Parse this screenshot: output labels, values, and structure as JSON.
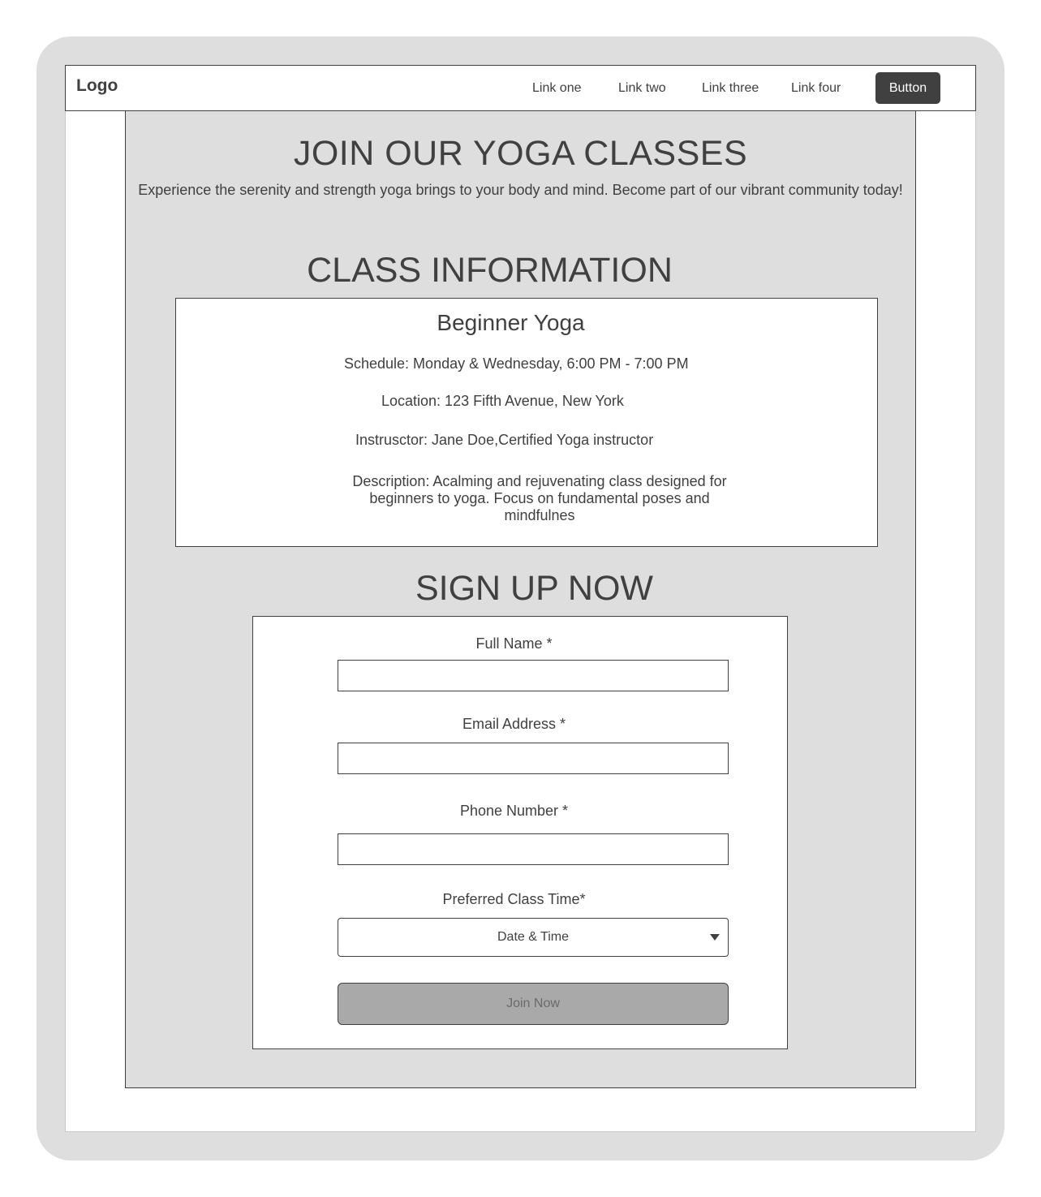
{
  "nav": {
    "logo": "Logo",
    "links": [
      "Link one",
      "Link two",
      "Link three",
      "Link four"
    ],
    "button": "Button"
  },
  "hero": {
    "title": "JOIN OUR YOGA CLASSES",
    "subtitle": "Experience the serenity and strength yoga brings to your body and mind. Become part of our vibrant community today!"
  },
  "class_info": {
    "heading": "CLASS INFORMATION",
    "name": "Beginner Yoga",
    "schedule": "Schedule: Monday & Wednesday, 6:00 PM - 7:00 PM",
    "location": "Location: 123 Fifth Avenue, New York",
    "instructor": "Instrusctor: Jane Doe,Certified Yoga instructor",
    "description": "Description: Acalming and rejuvenating class designed for beginners to yoga. Focus on fundamental poses and mindfulnes"
  },
  "signup": {
    "heading": "SIGN UP NOW",
    "full_name_label": "Full Name *",
    "email_label": "Email Address *",
    "phone_label": "Phone Number *",
    "class_time_label": "Preferred Class Time*",
    "class_time_value": "Date & Time",
    "submit_label": "Join Now"
  }
}
